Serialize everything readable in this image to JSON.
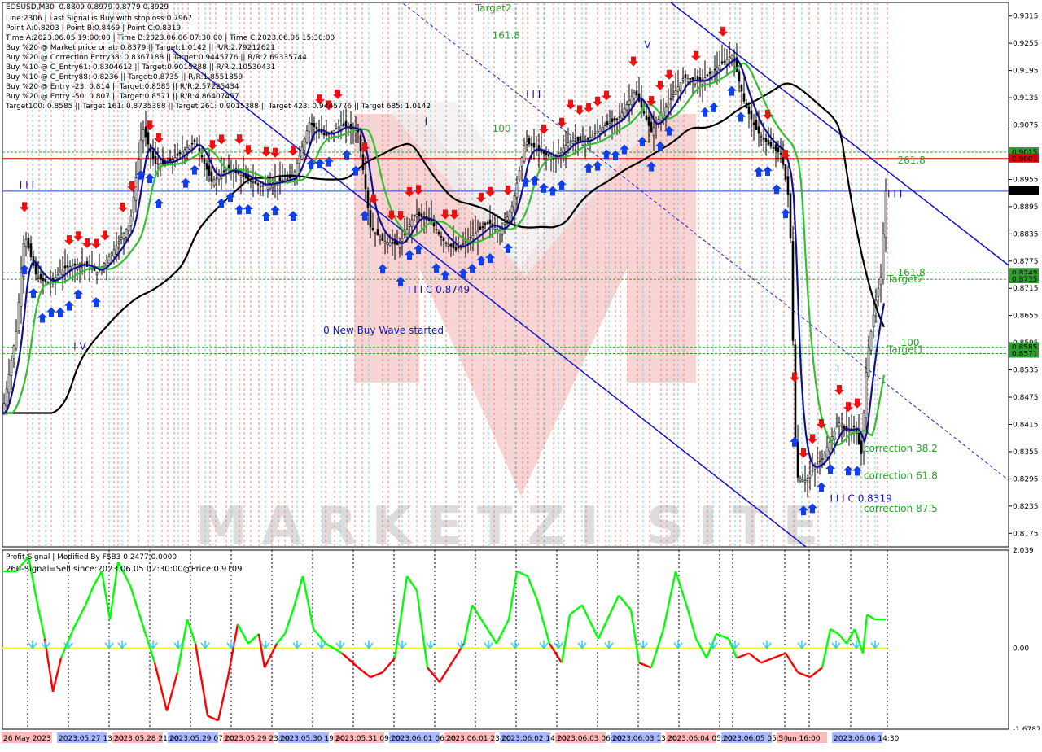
{
  "chart_data": [
    {
      "type": "candlestick",
      "title": "EOSUSD,M30",
      "ohlc_text": "0.8809 0.8979 0.8779 0.8929",
      "ylim": [
        0.8145,
        0.9345
      ],
      "y_ticks": [
        "0.9315",
        "0.9255",
        "0.9195",
        "0.9135",
        "0.9075",
        "0.9015",
        "0.8955",
        "0.8895",
        "0.8835",
        "0.8775",
        "0.8715",
        "0.8655",
        "0.8595",
        "0.8535",
        "0.8475",
        "0.8415",
        "0.8355",
        "0.8295",
        "0.8235",
        "0.8175"
      ],
      "info_lines": [
        "Line:2306 | Last Signal is:Buy with stoploss:0.7967",
        "Point A:0.8203 | Point B:0.8469 | Point C:0.8319",
        "Time A:2023.06.05 19:00:00 | Time B:2023.06.06 07:30:00 | Time C:2023.06.06 15:30:00",
        "Buy %20 @ Market price or at: 0.8379 || Target:1.0142 || R/R:2.79212621",
        "Buy %20 @ Correction Entry38: 0.8367188 || Target:0.9445776 || R/R:2.69335744",
        "Buy %10 @ C_Entry61: 0.8304612 || Target:0.9015388 || R/R:2.10530431",
        "Buy %10 @ C_Entry88: 0.8236 || Target:0.8735 || R/R:1.8551859",
        "Buy %20 @ Entry -23: 0.814 || Target:0.8585 || R/R:2.57225434",
        "Buy %20 @ Entry -50: 0.807 || Target:0.8571 || R/R:4.86407457",
        "Target100: 0.8585 || Target 161: 0.8735388 || Target 261: 0.9015388 || Target 423: 0.9445776 || Target 685: 1.0142"
      ],
      "price_badges": [
        {
          "label": "0.9015",
          "value": 0.9015,
          "color": "#2e9e2e"
        },
        {
          "label": "0.9001",
          "value": 0.9001,
          "color": "#e00000"
        },
        {
          "label": "0.8929",
          "value": 0.8929,
          "color": "#000000"
        },
        {
          "label": "0.8749",
          "value": 0.8749,
          "color": "#2e9e2e"
        },
        {
          "label": "0.8735",
          "value": 0.8735,
          "color": "#2e9e2e"
        },
        {
          "label": "0.8585",
          "value": 0.8585,
          "color": "#2e9e2e"
        },
        {
          "label": "0.8571",
          "value": 0.8571,
          "color": "#2e9e2e"
        }
      ],
      "annotations": [
        {
          "text": "Target2",
          "x": 0.14,
          "y": 0.9325,
          "color": "#2e9e2e"
        },
        {
          "text": "161.8",
          "x": 0.145,
          "y": 0.9265,
          "color": "#2e9e2e"
        },
        {
          "text": "100",
          "x": 0.145,
          "y": 0.906,
          "color": "#2e9e2e"
        },
        {
          "text": "I I I",
          "x": 0.155,
          "y": 0.9135,
          "color": "#1010c0"
        },
        {
          "text": "V",
          "x": 0.19,
          "y": 0.9245,
          "color": "#1010c0"
        },
        {
          "text": "I",
          "x": 0.125,
          "y": 0.9075,
          "color": "#1010c0"
        },
        {
          "text": "I I I",
          "x": 0.005,
          "y": 0.8935,
          "color": "#1010c0"
        },
        {
          "text": "I V",
          "x": 0.021,
          "y": 0.858,
          "color": "#1010c0"
        },
        {
          "text": "I I I C 0.8749",
          "x": 0.12,
          "y": 0.8705,
          "color": "#1010c0"
        },
        {
          "text": "0 New Buy Wave started",
          "x": 0.095,
          "y": 0.8615,
          "color": "#1010c0"
        },
        {
          "text": "261.8",
          "x": 0.265,
          "y": 0.899,
          "color": "#2e9e2e"
        },
        {
          "text": "I I I",
          "x": 0.262,
          "y": 0.8915,
          "color": "#1010c0"
        },
        {
          "text": "161.8",
          "x": 0.265,
          "y": 0.8742,
          "color": "#2e9e2e"
        },
        {
          "text": "Target2",
          "x": 0.262,
          "y": 0.8728,
          "color": "#2e9e2e"
        },
        {
          "text": "100",
          "x": 0.266,
          "y": 0.8588,
          "color": "#2e9e2e"
        },
        {
          "text": "Target1",
          "x": 0.262,
          "y": 0.8573,
          "color": "#2e9e2e"
        },
        {
          "text": "I",
          "x": 0.247,
          "y": 0.853,
          "color": "#1010c0"
        },
        {
          "text": "correction 38.2",
          "x": 0.255,
          "y": 0.8355,
          "color": "#2e9e2e"
        },
        {
          "text": "correction 61.8",
          "x": 0.255,
          "y": 0.8295,
          "color": "#2e9e2e"
        },
        {
          "text": "I I I C 0.8319",
          "x": 0.245,
          "y": 0.8245,
          "color": "#1010c0"
        },
        {
          "text": "correction 87.5",
          "x": 0.255,
          "y": 0.8222,
          "color": "#2e9e2e"
        }
      ],
      "watermark": "MARKETZI SITE"
    },
    {
      "type": "line",
      "title": "Profit-Signal | Modified By FSB3 0.2477 0.0000",
      "subtitle": "260-Signal=Sell since:2023.06.05 02:30:00@Price:0.9109",
      "ylim": [
        -1.6787,
        2.039
      ],
      "y_ticks": [
        "2.039",
        "0.00",
        "-1.6787"
      ],
      "zero_line_color": "#ffff00",
      "up_color": "#00ff00",
      "down_color": "#ff0000"
    }
  ],
  "time_axis": {
    "labels": [
      "26 May 2023",
      "2023.05.27 13:30",
      "2023.05.28 21:00",
      "2023.05.29 07:00",
      "2023.05.29 23:00",
      "2023.05.30 19:00",
      "2023.05.31 09:00",
      "2023.06.01 06:30",
      "2023.06.01 23:00",
      "2023.06.02 14:00",
      "2023.06.03 06:00",
      "2023.06.03 13:30",
      "2023.06.04 05:00",
      "2023.06.05 05:30",
      "5 Jun 16:00",
      "2023.06.06 14:30"
    ]
  }
}
